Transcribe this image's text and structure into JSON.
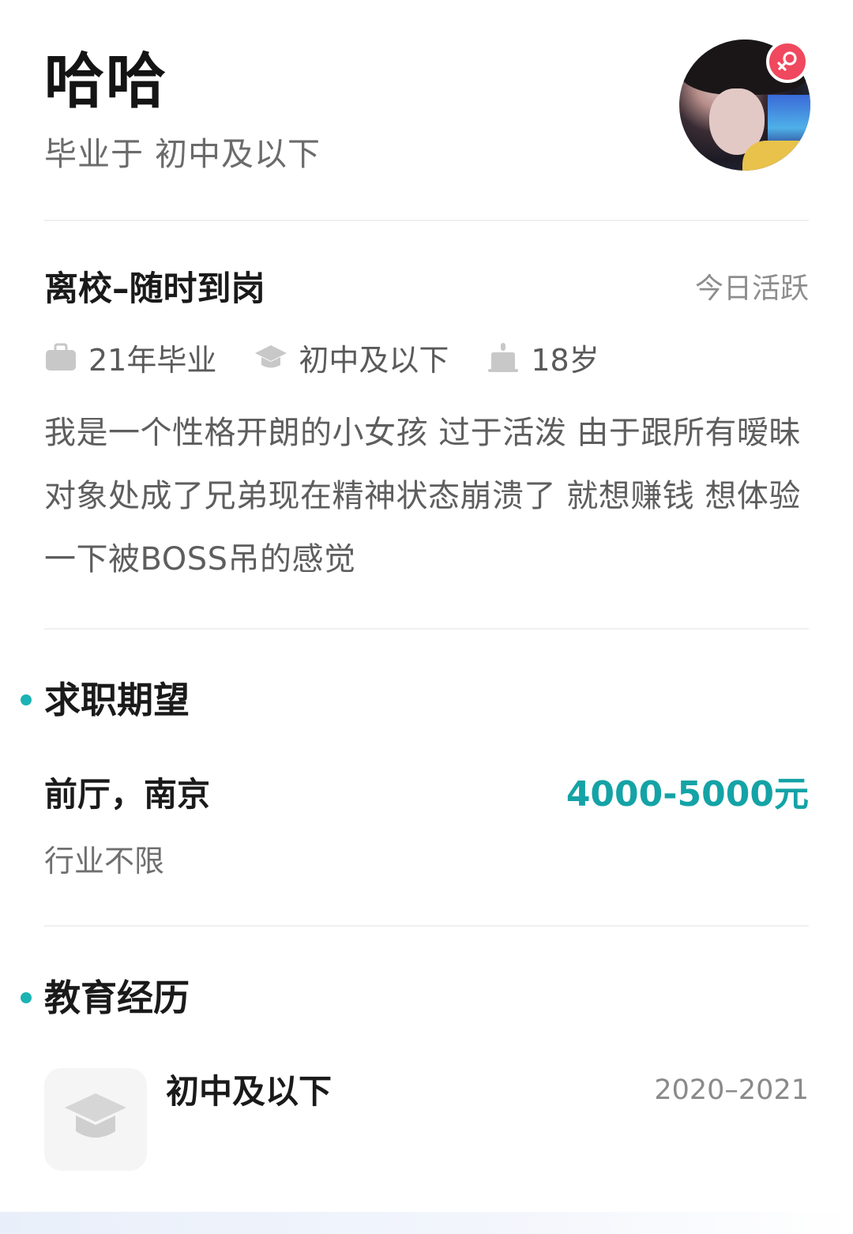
{
  "profile": {
    "name": "哈哈",
    "grad_line": "毕业于 初中及以下",
    "gender_icon": "female-icon",
    "badge_color": "#f0485e"
  },
  "status": {
    "title": "离校–随时到岗",
    "active": "今日活跃",
    "meta": [
      {
        "icon": "briefcase-icon",
        "text": "21年毕业"
      },
      {
        "icon": "graduation-cap-icon",
        "text": "初中及以下"
      },
      {
        "icon": "birthday-cake-icon",
        "text": "18岁"
      }
    ],
    "description": "我是一个性格开朗的小女孩 过于活泼 由于跟所有暧昧对象处成了兄弟现在精神状态崩溃了 就想赚钱 想体验一下被BOSS吊的感觉"
  },
  "expectation": {
    "section_title": "求职期望",
    "role": "前厅，南京",
    "salary": "4000-5000元",
    "industry": "行业不限",
    "salary_color": "#14a3a6"
  },
  "education": {
    "section_title": "教育经历",
    "school": "初中及以下",
    "years": "2020–2021"
  },
  "colors": {
    "accent": "#1bb3b3"
  }
}
